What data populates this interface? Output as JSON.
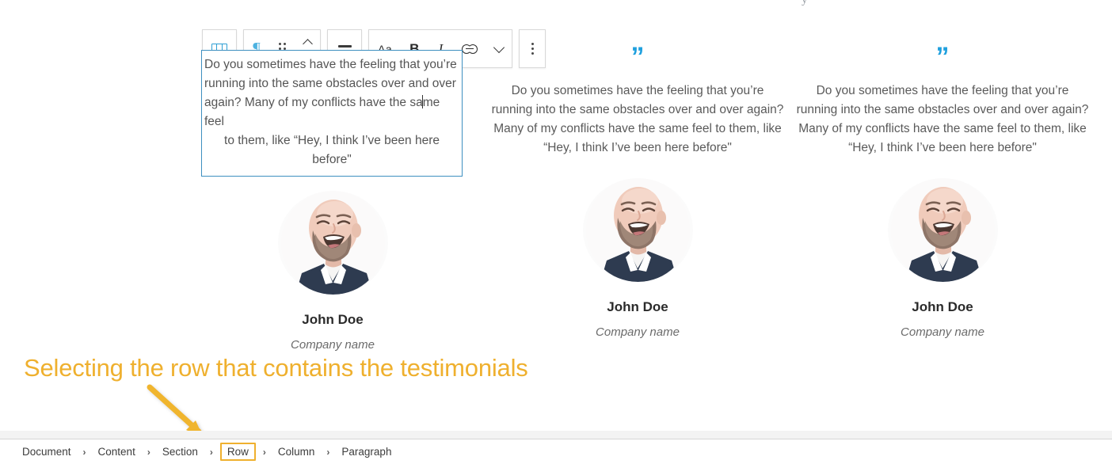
{
  "top_partial_glyph": "y",
  "toolbar": {
    "columns_button": {
      "icon": "columns-icon",
      "title": "Columns"
    },
    "paragraph_button": {
      "icon": "pilcrow-icon",
      "title": "Paragraph"
    },
    "drag_button": {
      "icon": "drag-dots-icon",
      "title": "Drag"
    },
    "move_button": {
      "icon": "move-up-down-icon",
      "title": "Move up or down"
    },
    "align_button": {
      "icon": "align-center-icon",
      "title": "Align center"
    },
    "font_button": {
      "label": "Aa",
      "icon": "font-size-icon"
    },
    "bold_button": {
      "label": "B",
      "icon": "bold-icon"
    },
    "italic_button": {
      "label": "I",
      "icon": "italic-icon"
    },
    "link_button": {
      "icon": "link-icon",
      "title": "Link"
    },
    "more_formats_button": {
      "icon": "chevron-down-icon"
    },
    "options_button": {
      "icon": "more-vertical-icon"
    }
  },
  "accent_colors": {
    "quote_blue": "#1fa0de",
    "selection_blue": "#3e8fc0",
    "annotation_orange": "#efb02e",
    "toolbar_icon_blue": "#2e9fd4"
  },
  "testimonials": [
    {
      "quote_icon": "”",
      "quote_line_1": "Do you sometimes have the feeling that you’re",
      "quote_line_2": "running into the same obstacles over and over",
      "quote_line_3a": "again? Many of my conflicts have the sa",
      "quote_line_3b": "me feel",
      "quote_line_4": "to them, like “Hey, I think I’ve been here",
      "quote_line_5": "before\"",
      "name": "John Doe",
      "company": "Company name",
      "selected": true
    },
    {
      "quote_icon": "”",
      "quote": "Do you sometimes have the feeling that you’re running into the same obstacles over and over again? Many of my conflicts have the same feel to them, like “Hey, I think I’ve been here before\"",
      "name": "John Doe",
      "company": "Company name",
      "selected": false
    },
    {
      "quote_icon": "”",
      "quote": "Do you sometimes have the feeling that you’re running into the same obstacles over and over again? Many of my conflicts have the same feel to them, like “Hey, I think I’ve been here before\"",
      "name": "John Doe",
      "company": "Company name",
      "selected": false
    }
  ],
  "annotation": {
    "text": "Selecting the row that contains the testimonials",
    "arrow": "down-right-arrow"
  },
  "breadcrumb": {
    "items": [
      {
        "label": "Document",
        "active": false
      },
      {
        "label": "Content",
        "active": false
      },
      {
        "label": "Section",
        "active": false
      },
      {
        "label": "Row",
        "active": true
      },
      {
        "label": "Column",
        "active": false
      },
      {
        "label": "Paragraph",
        "active": false
      }
    ],
    "separator": "›"
  }
}
